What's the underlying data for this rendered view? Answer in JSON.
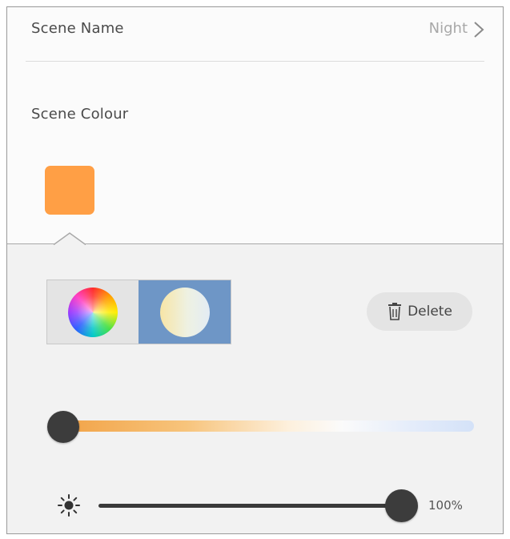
{
  "scene": {
    "name_label": "Scene Name",
    "name_value": "Night",
    "colour_label": "Scene Colour",
    "colour_hex": "#ff9f45"
  },
  "picker": {
    "modes": [
      {
        "id": "color-wheel",
        "icon": "color-wheel-icon",
        "selected": false
      },
      {
        "id": "white-temperature",
        "icon": "warm-white-icon",
        "selected": true
      }
    ],
    "delete_label": "Delete"
  },
  "temperature": {
    "level": 0.0,
    "gradient_start": "#f2a347",
    "gradient_end": "#d4e2f8"
  },
  "brightness": {
    "icon": "sun-icon",
    "percent": 100,
    "value_label": "100%"
  },
  "colors": {
    "accent_selected": "#6e96c6",
    "knob": "#3c3c3c"
  }
}
